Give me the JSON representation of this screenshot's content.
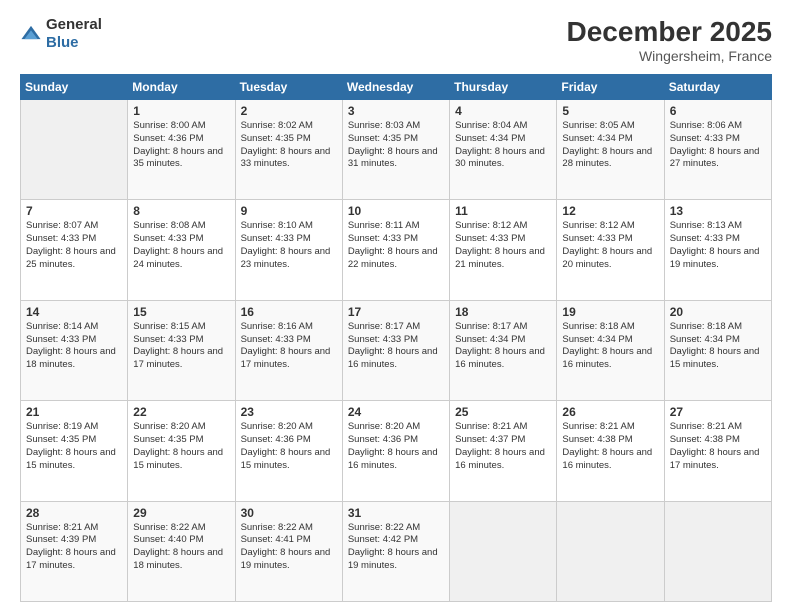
{
  "header": {
    "logo_general": "General",
    "logo_blue": "Blue",
    "month_title": "December 2025",
    "location": "Wingersheim, France"
  },
  "columns": [
    "Sunday",
    "Monday",
    "Tuesday",
    "Wednesday",
    "Thursday",
    "Friday",
    "Saturday"
  ],
  "weeks": [
    [
      {
        "day": "",
        "sunrise": "",
        "sunset": "",
        "daylight": ""
      },
      {
        "day": "1",
        "sunrise": "Sunrise: 8:00 AM",
        "sunset": "Sunset: 4:36 PM",
        "daylight": "Daylight: 8 hours and 35 minutes."
      },
      {
        "day": "2",
        "sunrise": "Sunrise: 8:02 AM",
        "sunset": "Sunset: 4:35 PM",
        "daylight": "Daylight: 8 hours and 33 minutes."
      },
      {
        "day": "3",
        "sunrise": "Sunrise: 8:03 AM",
        "sunset": "Sunset: 4:35 PM",
        "daylight": "Daylight: 8 hours and 31 minutes."
      },
      {
        "day": "4",
        "sunrise": "Sunrise: 8:04 AM",
        "sunset": "Sunset: 4:34 PM",
        "daylight": "Daylight: 8 hours and 30 minutes."
      },
      {
        "day": "5",
        "sunrise": "Sunrise: 8:05 AM",
        "sunset": "Sunset: 4:34 PM",
        "daylight": "Daylight: 8 hours and 28 minutes."
      },
      {
        "day": "6",
        "sunrise": "Sunrise: 8:06 AM",
        "sunset": "Sunset: 4:33 PM",
        "daylight": "Daylight: 8 hours and 27 minutes."
      }
    ],
    [
      {
        "day": "7",
        "sunrise": "Sunrise: 8:07 AM",
        "sunset": "Sunset: 4:33 PM",
        "daylight": "Daylight: 8 hours and 25 minutes."
      },
      {
        "day": "8",
        "sunrise": "Sunrise: 8:08 AM",
        "sunset": "Sunset: 4:33 PM",
        "daylight": "Daylight: 8 hours and 24 minutes."
      },
      {
        "day": "9",
        "sunrise": "Sunrise: 8:10 AM",
        "sunset": "Sunset: 4:33 PM",
        "daylight": "Daylight: 8 hours and 23 minutes."
      },
      {
        "day": "10",
        "sunrise": "Sunrise: 8:11 AM",
        "sunset": "Sunset: 4:33 PM",
        "daylight": "Daylight: 8 hours and 22 minutes."
      },
      {
        "day": "11",
        "sunrise": "Sunrise: 8:12 AM",
        "sunset": "Sunset: 4:33 PM",
        "daylight": "Daylight: 8 hours and 21 minutes."
      },
      {
        "day": "12",
        "sunrise": "Sunrise: 8:12 AM",
        "sunset": "Sunset: 4:33 PM",
        "daylight": "Daylight: 8 hours and 20 minutes."
      },
      {
        "day": "13",
        "sunrise": "Sunrise: 8:13 AM",
        "sunset": "Sunset: 4:33 PM",
        "daylight": "Daylight: 8 hours and 19 minutes."
      }
    ],
    [
      {
        "day": "14",
        "sunrise": "Sunrise: 8:14 AM",
        "sunset": "Sunset: 4:33 PM",
        "daylight": "Daylight: 8 hours and 18 minutes."
      },
      {
        "day": "15",
        "sunrise": "Sunrise: 8:15 AM",
        "sunset": "Sunset: 4:33 PM",
        "daylight": "Daylight: 8 hours and 17 minutes."
      },
      {
        "day": "16",
        "sunrise": "Sunrise: 8:16 AM",
        "sunset": "Sunset: 4:33 PM",
        "daylight": "Daylight: 8 hours and 17 minutes."
      },
      {
        "day": "17",
        "sunrise": "Sunrise: 8:17 AM",
        "sunset": "Sunset: 4:33 PM",
        "daylight": "Daylight: 8 hours and 16 minutes."
      },
      {
        "day": "18",
        "sunrise": "Sunrise: 8:17 AM",
        "sunset": "Sunset: 4:34 PM",
        "daylight": "Daylight: 8 hours and 16 minutes."
      },
      {
        "day": "19",
        "sunrise": "Sunrise: 8:18 AM",
        "sunset": "Sunset: 4:34 PM",
        "daylight": "Daylight: 8 hours and 16 minutes."
      },
      {
        "day": "20",
        "sunrise": "Sunrise: 8:18 AM",
        "sunset": "Sunset: 4:34 PM",
        "daylight": "Daylight: 8 hours and 15 minutes."
      }
    ],
    [
      {
        "day": "21",
        "sunrise": "Sunrise: 8:19 AM",
        "sunset": "Sunset: 4:35 PM",
        "daylight": "Daylight: 8 hours and 15 minutes."
      },
      {
        "day": "22",
        "sunrise": "Sunrise: 8:20 AM",
        "sunset": "Sunset: 4:35 PM",
        "daylight": "Daylight: 8 hours and 15 minutes."
      },
      {
        "day": "23",
        "sunrise": "Sunrise: 8:20 AM",
        "sunset": "Sunset: 4:36 PM",
        "daylight": "Daylight: 8 hours and 15 minutes."
      },
      {
        "day": "24",
        "sunrise": "Sunrise: 8:20 AM",
        "sunset": "Sunset: 4:36 PM",
        "daylight": "Daylight: 8 hours and 16 minutes."
      },
      {
        "day": "25",
        "sunrise": "Sunrise: 8:21 AM",
        "sunset": "Sunset: 4:37 PM",
        "daylight": "Daylight: 8 hours and 16 minutes."
      },
      {
        "day": "26",
        "sunrise": "Sunrise: 8:21 AM",
        "sunset": "Sunset: 4:38 PM",
        "daylight": "Daylight: 8 hours and 16 minutes."
      },
      {
        "day": "27",
        "sunrise": "Sunrise: 8:21 AM",
        "sunset": "Sunset: 4:38 PM",
        "daylight": "Daylight: 8 hours and 17 minutes."
      }
    ],
    [
      {
        "day": "28",
        "sunrise": "Sunrise: 8:21 AM",
        "sunset": "Sunset: 4:39 PM",
        "daylight": "Daylight: 8 hours and 17 minutes."
      },
      {
        "day": "29",
        "sunrise": "Sunrise: 8:22 AM",
        "sunset": "Sunset: 4:40 PM",
        "daylight": "Daylight: 8 hours and 18 minutes."
      },
      {
        "day": "30",
        "sunrise": "Sunrise: 8:22 AM",
        "sunset": "Sunset: 4:41 PM",
        "daylight": "Daylight: 8 hours and 19 minutes."
      },
      {
        "day": "31",
        "sunrise": "Sunrise: 8:22 AM",
        "sunset": "Sunset: 4:42 PM",
        "daylight": "Daylight: 8 hours and 19 minutes."
      },
      {
        "day": "",
        "sunrise": "",
        "sunset": "",
        "daylight": ""
      },
      {
        "day": "",
        "sunrise": "",
        "sunset": "",
        "daylight": ""
      },
      {
        "day": "",
        "sunrise": "",
        "sunset": "",
        "daylight": ""
      }
    ]
  ]
}
